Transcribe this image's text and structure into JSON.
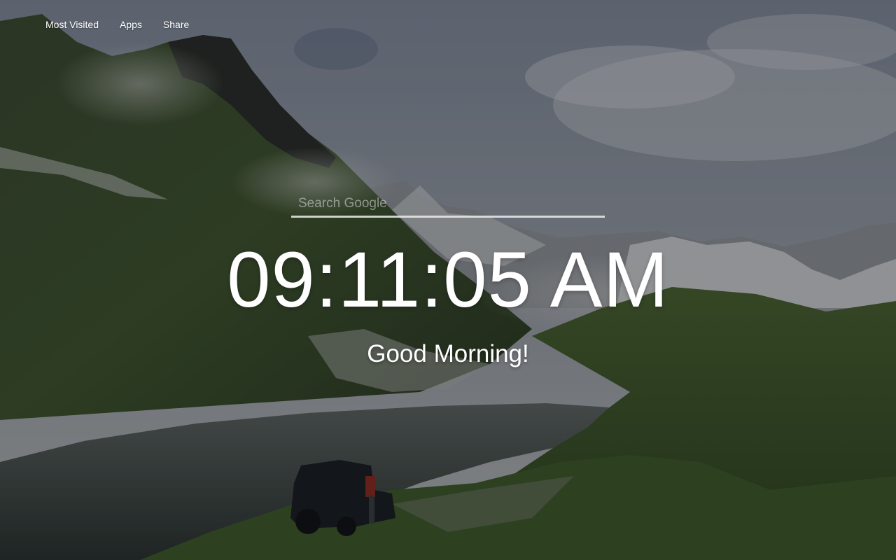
{
  "nav": {
    "items": [
      {
        "label": "Most Visited"
      },
      {
        "label": "Apps"
      },
      {
        "label": "Share"
      }
    ]
  },
  "search": {
    "placeholder": "Search Google",
    "value": ""
  },
  "clock": {
    "time": "09:11:05 AM"
  },
  "greeting": {
    "text": "Good Morning!"
  },
  "background": {
    "subject": "mountain-lake-landscape-with-jeep",
    "sky_color": "#7d8799",
    "overlay_color": "#000000"
  }
}
